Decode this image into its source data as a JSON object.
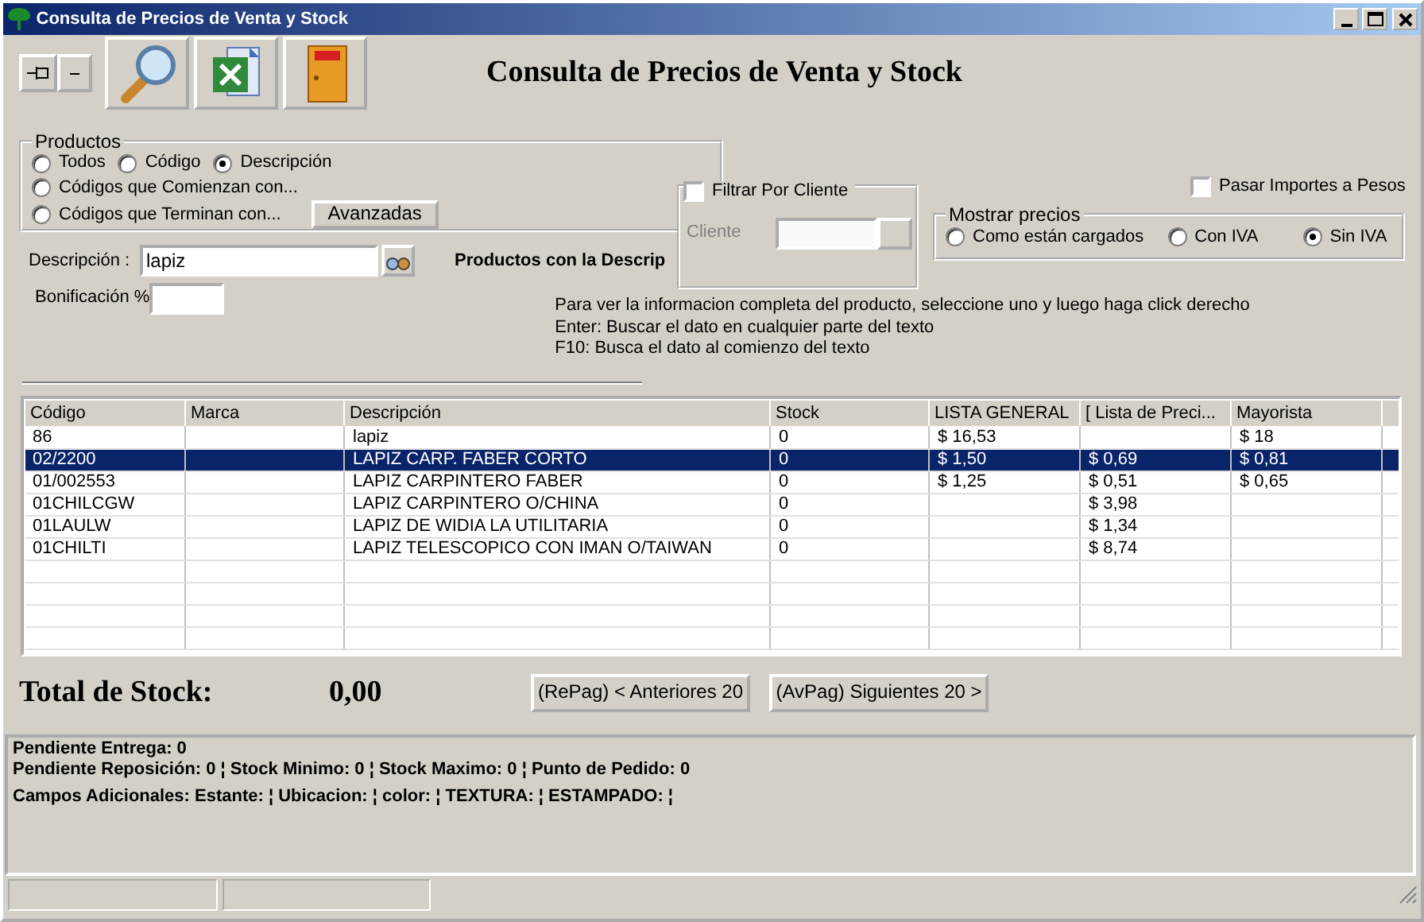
{
  "window": {
    "title": "Consulta de Precios de Venta y Stock"
  },
  "toolbar": {
    "buttons": [
      {
        "kind": "pin"
      },
      {
        "kind": "minus"
      },
      {
        "kind": "search"
      },
      {
        "kind": "excel"
      },
      {
        "kind": "exit"
      }
    ]
  },
  "heading": "Consulta de Precios de Venta y Stock",
  "productos": {
    "legend": "Productos",
    "options": [
      {
        "label": "Todos",
        "selected": false
      },
      {
        "label": "Código",
        "selected": false
      },
      {
        "label": "Descripción",
        "selected": true
      },
      {
        "label": "Códigos que Comienzan con...",
        "selected": false
      },
      {
        "label": "Códigos que Terminan con...",
        "selected": false
      }
    ],
    "advanced_button": "Avanzadas"
  },
  "description_field": {
    "label": "Descripción :",
    "value": "lapiz"
  },
  "bonus_field": {
    "label": "Bonificación %"
  },
  "results_label": "Productos con la Descrip",
  "client_filter": {
    "label": "Filtrar Por Cliente",
    "checked": false,
    "client_label": "Cliente"
  },
  "convert_pesos": {
    "label": "Pasar Importes a Pesos",
    "checked": false
  },
  "price_mode": {
    "legend": "Mostrar precios",
    "options": [
      {
        "label": "Como están cargados",
        "selected": false
      },
      {
        "label": "Con IVA",
        "selected": false
      },
      {
        "label": "Sin IVA",
        "selected": true
      }
    ]
  },
  "hints": [
    "Para ver la informacion completa del producto, seleccione uno y luego haga click derecho",
    "Enter: Buscar el dato en cualquier parte del texto",
    "F10: Busca el dato al comienzo del texto"
  ],
  "table": {
    "columns": [
      "Código",
      "Marca",
      "Descripción",
      "Stock",
      "LISTA GENERAL",
      "[ Lista de Preci...",
      "Mayorista"
    ],
    "rows": [
      {
        "cells": [
          "86",
          "",
          "lapiz",
          "0",
          "$ 16,53",
          "",
          "$ 18"
        ],
        "selected": false
      },
      {
        "cells": [
          "02/2200",
          "",
          "LAPIZ CARP. FABER CORTO",
          "0",
          "$ 1,50",
          "$ 0,69",
          "$ 0,81"
        ],
        "selected": true
      },
      {
        "cells": [
          "01/002553",
          "",
          "LAPIZ CARPINTERO FABER",
          "0",
          "$ 1,25",
          "$ 0,51",
          "$ 0,65"
        ],
        "selected": false
      },
      {
        "cells": [
          "01CHILCGW",
          "",
          "LAPIZ CARPINTERO O/CHINA",
          "0",
          "",
          "$ 3,98",
          ""
        ],
        "selected": false
      },
      {
        "cells": [
          "01LAULW",
          "",
          "LAPIZ DE WIDIA LA UTILITARIA",
          "0",
          "",
          "$ 1,34",
          ""
        ],
        "selected": false
      },
      {
        "cells": [
          "01CHILTI",
          "",
          "LAPIZ TELESCOPICO CON IMAN O/TAIWAN",
          "0",
          "",
          "$ 8,74",
          ""
        ],
        "selected": false
      }
    ]
  },
  "total": {
    "label": "Total de Stock:",
    "value": "0,00"
  },
  "pager": [
    "(RePag) < Anteriores 20",
    "(AvPag) Siguientes 20 >"
  ],
  "details": [
    "Pendiente Entrega: 0",
    "Pendiente Reposición: 0 ¦ Stock Minimo: 0 ¦ Stock Maximo: 0 ¦ Punto de Pedido: 0",
    "Campos Adicionales: Estante: ¦ Ubicacion: ¦ color: ¦ TEXTURA: ¦ ESTAMPADO: ¦"
  ]
}
